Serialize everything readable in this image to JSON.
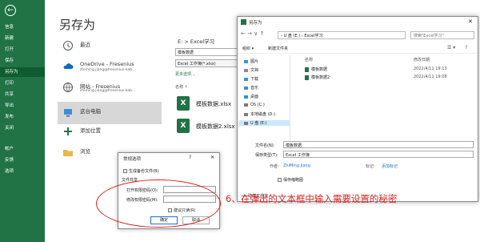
{
  "nav": {
    "back_glyph": "←",
    "items": [
      "信息",
      "新建",
      "打开",
      "保存",
      "另存为",
      "打印",
      "共享",
      "导出",
      "发布",
      "关闭",
      "帐户",
      "反馈",
      "选项"
    ]
  },
  "page": {
    "title": "另存为",
    "locations": [
      {
        "icon": "clock-icon",
        "title": "最近",
        "subtitle": ""
      },
      {
        "icon": "onedrive-icon",
        "title": "OneDrive - Fresenius",
        "subtitle": "zhiming.jiang@fresenius-kab..."
      },
      {
        "icon": "globe-icon",
        "title": "网站 - Fresenius",
        "subtitle": "zhiming.jiang@fresenius-kab..."
      },
      {
        "icon": "pc-icon",
        "title": "这台电脑",
        "subtitle": ""
      },
      {
        "icon": "plus-icon",
        "title": "添加位置",
        "subtitle": ""
      },
      {
        "icon": "folder-icon",
        "title": "浏览",
        "subtitle": ""
      }
    ]
  },
  "middle": {
    "path": "E: > Excel学习",
    "filename": "模板数据",
    "filetype": "Excel 工作簿(*.xlsx)",
    "more_options": "更多选项...",
    "col_name": "名称 ↑",
    "files": [
      "模板数据.xlsx",
      "模板数据2.xlsx"
    ]
  },
  "save_dialog": {
    "title": "另存为",
    "close": "✕",
    "nav_arrows": "← → ∨ ↑",
    "address": "› U 盘 (E:) › Excel学习",
    "search_placeholder": "搜索\"Excel学习\"",
    "toolbar": {
      "organize": "组织 ▾",
      "new_folder": "新建文件夹",
      "view": "☰ ▾",
      "help": "?"
    },
    "tree": [
      {
        "label": "图片",
        "color": "#3b8ed8"
      },
      {
        "label": "文档",
        "color": "#8c8c8c"
      },
      {
        "label": "下载",
        "color": "#3b8ed8"
      },
      {
        "label": "音乐",
        "color": "#3b8ed8"
      },
      {
        "label": "桌面",
        "color": "#3b8ed8"
      },
      {
        "label": "OS (C:)",
        "color": "#7a7a7a"
      },
      {
        "label": "本地磁盘 (D:)",
        "color": "#7a7a7a"
      },
      {
        "label": "U 盘 (E:)",
        "color": "#7a7a7a"
      }
    ],
    "col_name": "名称",
    "col_date": "修改日期",
    "files": [
      {
        "name": "模板数据",
        "date": "2022/4/11 19:13"
      },
      {
        "name": "模板数据2",
        "date": "2022/4/11 19:08"
      }
    ],
    "filename_label": "文件名(N):",
    "filename_value": "模板数据",
    "filetype_label": "保存类型(T):",
    "filetype_value": "Excel 工作簿",
    "author_label": "作者:",
    "author_value": "ZhiMing Jiang",
    "tags_label": "标记:",
    "tags_value": "添加标记",
    "thumbnail_label": "保存缩略图",
    "hide_folders": "∧ 隐藏文件夹"
  },
  "options_dialog": {
    "title": "常规选项",
    "help": "?",
    "close": "✕",
    "backup_label": "生成备份文件(B)",
    "share_label": "文件共享",
    "open_pwd_label": "打开权限密码(O):",
    "modify_pwd_label": "修改权限密码(M):",
    "readonly_label": "建议只读(R)",
    "ok": "确定",
    "cancel": "取消"
  },
  "annotation": "6、在弹出的文本框中输入需要设置的秘密",
  "colors": {
    "nav_bg": "#217346",
    "accent_red": "#e02020",
    "link_blue": "#1e6fd9"
  }
}
